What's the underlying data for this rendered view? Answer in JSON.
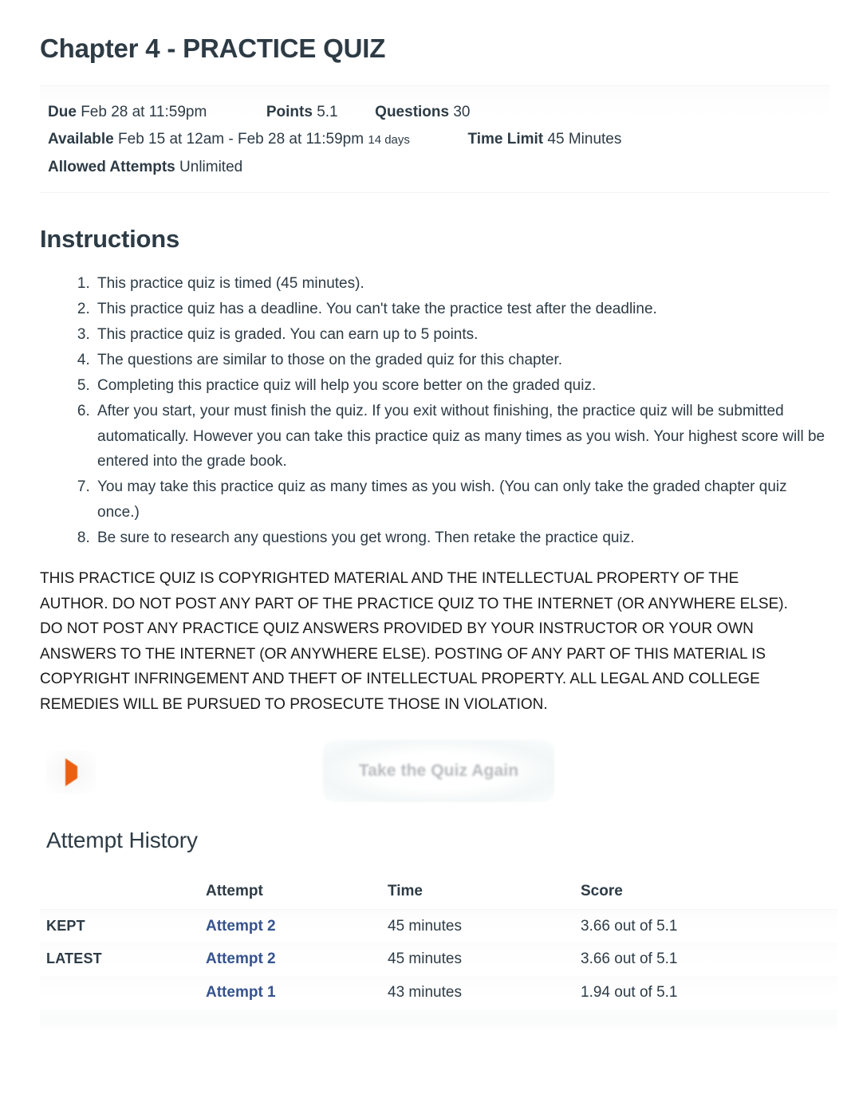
{
  "quiz": {
    "title": "Chapter 4 - PRACTICE QUIZ",
    "meta": {
      "due_label": "Due",
      "due_value": "Feb 28 at 11:59pm",
      "points_label": "Points",
      "points_value": "5.1",
      "questions_label": "Questions",
      "questions_value": "30",
      "available_label": "Available",
      "available_value": "Feb 15 at 12am - Feb 28 at 11:59pm",
      "available_duration": "14 days",
      "time_limit_label": "Time Limit",
      "time_limit_value": "45 Minutes",
      "allowed_attempts_label": "Allowed Attempts",
      "allowed_attempts_value": "Unlimited"
    }
  },
  "instructions": {
    "heading": "Instructions",
    "items": [
      "This practice quiz is timed (45 minutes).",
      "This practice quiz has a deadline. You can't take the practice test after the deadline.",
      "This practice quiz is graded. You can earn up to 5 points.",
      "The questions are similar to those on the graded quiz for this chapter.",
      "Completing this practice quiz will help you score better on the graded quiz.",
      "After you start, your must finish the quiz. If you exit without finishing, the practice quiz will be submitted automatically. However you can take this practice quiz as many times as you wish. Your highest score will be entered into the grade book.",
      "You may take this practice quiz as many times as you wish. (You can only take the graded chapter quiz once.)",
      "Be sure to research any questions you get wrong. Then retake the practice quiz."
    ],
    "copyright": "THIS PRACTICE QUIZ IS COPYRIGHTED MATERIAL AND THE INTELLECTUAL PROPERTY OF THE AUTHOR. DO NOT POST ANY PART OF THE PRACTICE QUIZ TO THE INTERNET (OR ANYWHERE ELSE). DO NOT POST ANY PRACTICE QUIZ ANSWERS PROVIDED BY YOUR INSTRUCTOR OR YOUR OWN ANSWERS TO THE INTERNET (OR ANYWHERE ELSE). POSTING OF ANY PART OF THIS MATERIAL IS COPYRIGHT INFRINGEMENT AND THEFT OF INTELLECTUAL PROPERTY. ALL LEGAL AND COLLEGE REMEDIES WILL BE PURSUED TO PROSECUTE THOSE IN VIOLATION."
  },
  "actions": {
    "play_icon": "play-icon",
    "take_quiz_label": "Take the Quiz Again"
  },
  "attempt_history": {
    "heading": "Attempt History",
    "columns": {
      "flag": "",
      "attempt": "Attempt",
      "time": "Time",
      "score": "Score"
    },
    "rows": [
      {
        "flag": "KEPT",
        "attempt": "Attempt 2",
        "time": "45 minutes",
        "score": "3.66 out of 5.1"
      },
      {
        "flag": "LATEST",
        "attempt": "Attempt 2",
        "time": "45 minutes",
        "score": "3.66 out of 5.1"
      },
      {
        "flag": "",
        "attempt": "Attempt 1",
        "time": "43 minutes",
        "score": "1.94 out of 5.1"
      }
    ]
  },
  "colors": {
    "text": "#2D3B45",
    "link": "#36538e",
    "accent_orange": "#ec5e10",
    "disabled_text": "#b6babd"
  }
}
